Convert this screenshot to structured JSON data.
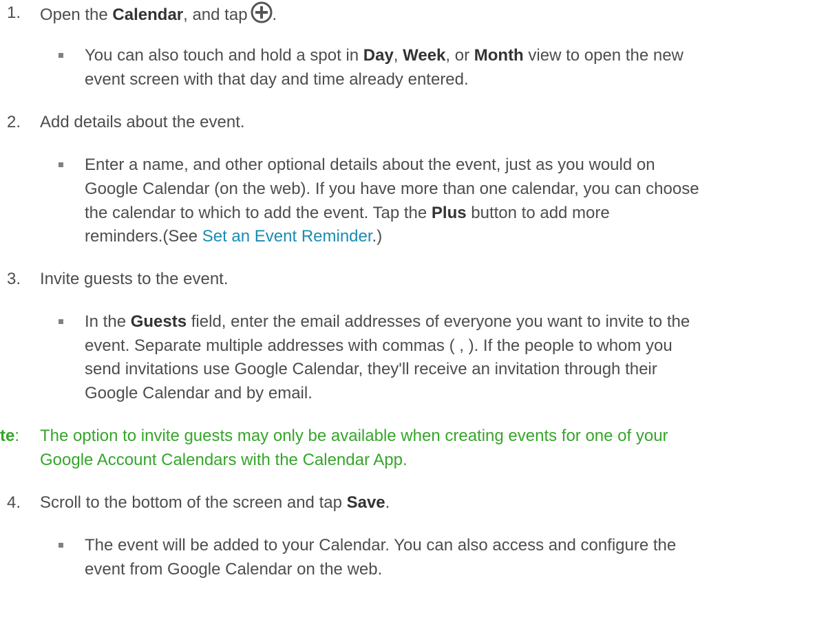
{
  "steps": [
    {
      "number": "1.",
      "text_before": "Open the ",
      "bold": "Calendar",
      "text_after": ", and tap",
      "icon": "plus-circle-icon",
      "end": ".",
      "bullet": {
        "l1a": "You can also touch and hold a spot in ",
        "day": "Day",
        "c1": ", ",
        "week": "Week",
        "c2": ", or ",
        "month": "Month",
        "l1b": " view to open the new",
        "l2": "event screen with that day and time already entered."
      }
    },
    {
      "number": "2.",
      "text": "Add details about the event.",
      "bullet": {
        "l1": "Enter a name, and other optional details about the event, just as you would on",
        "l2": "Google Calendar (on the web). If you have more than one calendar, you can choose",
        "l3a": "the calendar to which to add the event. Tap the ",
        "plus": "Plus",
        "l3b": " button to add more",
        "l4a": "reminders.(See ",
        "link": "Set an Event Reminder",
        "l4b": ".)"
      }
    },
    {
      "number": "3.",
      "text": "Invite guests to the event.",
      "bullet": {
        "l1a": "In the ",
        "guests": "Guests",
        "l1b": " field, enter the email addresses of everyone you want to invite to the",
        "l2": "event. Separate multiple addresses with commas ( , ). If the people to whom you",
        "l3": "send invitations use Google Calendar, they'll receive an invitation through their",
        "l4": "Google Calendar and by email."
      }
    },
    {
      "number": "4.",
      "text_before": "Scroll to the bottom of the screen and tap ",
      "bold": "Save",
      "end": ".",
      "bullet": {
        "l1": "The event will be added to your Calendar. You can also access and configure the",
        "l2": "event from Google Calendar on the web."
      }
    }
  ],
  "note": {
    "label": "te",
    "colon": ":",
    "l1": "The option to invite guests may only be available when creating events for one of your",
    "l2": "Google Account Calendars with the Calendar App."
  },
  "colors": {
    "text": "#4d4d4d",
    "link": "#1a8bb3",
    "note": "#36a52a"
  }
}
